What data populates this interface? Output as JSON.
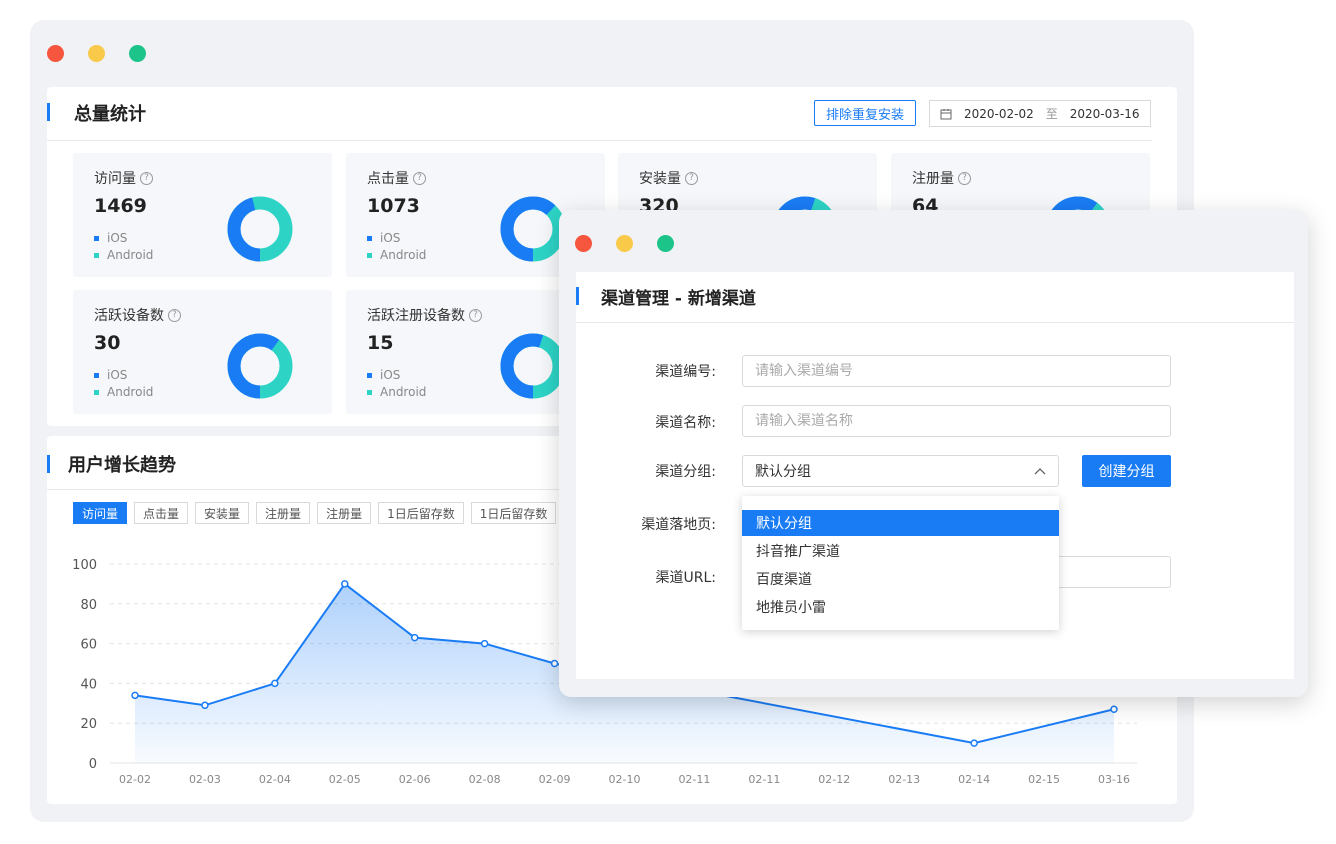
{
  "dashboard": {
    "title": "总量统计",
    "exclude_button": "排除重复安装",
    "date_start": "2020-02-02",
    "date_sep": "至",
    "date_end": "2020-03-16",
    "stats": [
      {
        "label": "访问量",
        "value": "1469",
        "ios_pct": 0.46
      },
      {
        "label": "点击量",
        "value": "1073",
        "ios_pct": 0.62
      },
      {
        "label": "安装量",
        "value": "320",
        "ios_pct": 0.55
      },
      {
        "label": "注册量",
        "value": "64",
        "ios_pct": 0.6
      },
      {
        "label": "活跃设备数",
        "value": "30",
        "ios_pct": 0.6
      },
      {
        "label": "活跃注册设备数",
        "value": "15",
        "ios_pct": 0.55
      }
    ],
    "legend": {
      "ios": "iOS",
      "android": "Android"
    },
    "help_glyph": "?"
  },
  "colors": {
    "accent": "#1a7cf5",
    "teal": "#2dd4c6",
    "ios": "#1a7cf5",
    "android": "#2dd4c6"
  },
  "growth": {
    "title": "用户增长趋势",
    "tabs": [
      "访问量",
      "点击量",
      "安装量",
      "注册量",
      "注册量",
      "1日后留存数",
      "1日后留存数"
    ]
  },
  "chart_data": {
    "type": "area",
    "title": "用户增长趋势",
    "x": [
      "02-02",
      "02-03",
      "02-04",
      "02-05",
      "02-06",
      "02-08",
      "02-09",
      "02-10",
      "02-11",
      "02-11",
      "02-12",
      "02-13",
      "02-14",
      "02-15",
      "03-16"
    ],
    "series": [
      {
        "values": [
          34,
          29,
          40,
          90,
          63,
          60,
          50,
          null,
          null,
          null,
          null,
          null,
          10,
          null,
          27
        ]
      }
    ],
    "y_ticks": [
      "0",
      "20",
      "40",
      "60",
      "80",
      "100"
    ],
    "ylim": [
      0,
      100
    ],
    "grid": "horizontal dashed"
  },
  "dialog": {
    "title": "渠道管理 - 新增渠道",
    "fields": {
      "code_label": "渠道编号:",
      "code_placeholder": "请输入渠道编号",
      "name_label": "渠道名称:",
      "name_placeholder": "请输入渠道名称",
      "group_label": "渠道分组:",
      "group_value": "默认分组",
      "landing_label": "渠道落地页:",
      "url_label": "渠道URL:"
    },
    "create_group_button": "创建分组",
    "group_options": [
      "默认分组",
      "抖音推广渠道",
      "百度渠道",
      "地推员小雷"
    ],
    "selected_option_index": 0
  }
}
